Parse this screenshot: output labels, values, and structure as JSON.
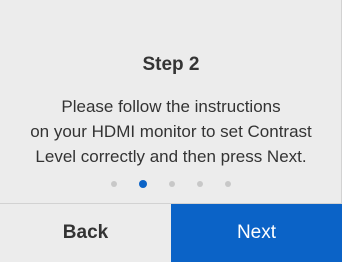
{
  "dialog": {
    "title": "Step 2",
    "message": "Please follow the instructions\non your HDMI monitor to set Contrast\nLevel correctly and then press Next."
  },
  "pager": {
    "total_steps": 5,
    "current_step": 2
  },
  "buttons": {
    "back_label": "Back",
    "next_label": "Next"
  },
  "colors": {
    "accent": "#0b63c7",
    "panel_background": "#ececec",
    "inactive_dot": "#c8c8c8"
  }
}
